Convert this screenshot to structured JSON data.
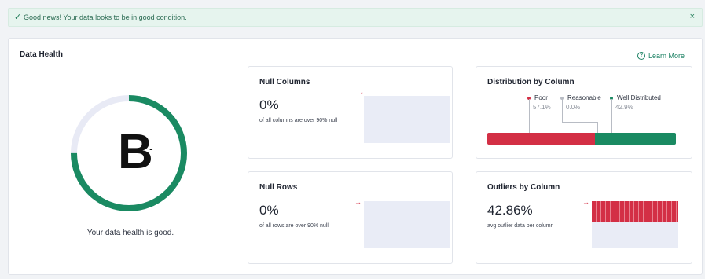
{
  "banner": {
    "icon": "check-icon",
    "message": "Good news! Your data looks to be in good condition.",
    "close": "×"
  },
  "panel": {
    "title": "Data Health",
    "learn_more": "Learn More",
    "learn_icon": "help-circle-icon"
  },
  "gauge": {
    "grade": "B",
    "grade_modifier": "-",
    "fraction": 0.75,
    "summary": "Your data health is good.",
    "colors": {
      "fill": "#1a8a62",
      "track": "#e8eaf5"
    }
  },
  "null_columns": {
    "title": "Null Columns",
    "value": "0%",
    "caption": "of all columns are over 90% null",
    "fraction": 0
  },
  "null_rows": {
    "title": "Null Rows",
    "value": "0%",
    "caption": "of all rows are over 90% null",
    "fraction": 0
  },
  "distribution": {
    "title": "Distribution by Column",
    "items": [
      {
        "label": "Poor",
        "value": "57.1%",
        "fraction": 0.571,
        "color": "#d32f45"
      },
      {
        "label": "Reasonable",
        "value": "0.0%",
        "fraction": 0.0,
        "color": "#b8bcc4"
      },
      {
        "label": "Well Distributed",
        "value": "42.9%",
        "fraction": 0.429,
        "color": "#1a8a62"
      }
    ]
  },
  "outliers": {
    "title": "Outliers by Column",
    "value": "42.86%",
    "caption": "avg outlier data per column",
    "fraction": 0.4286,
    "color": "#d32f45"
  }
}
